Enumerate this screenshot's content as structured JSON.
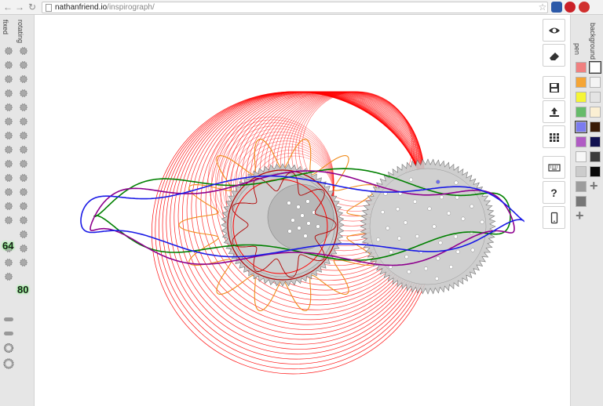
{
  "browser": {
    "url_host": "nathanfriend.io",
    "url_path": "/inspirograph/",
    "nav": [
      "back-icon",
      "forward-icon",
      "reload-icon"
    ],
    "extensions": [
      "star-icon",
      "bookmark-extension-icon",
      "pinterest-icon",
      "opera-icon"
    ]
  },
  "left_panel": {
    "fixed_label": "fixed",
    "rotating_label": "rotating",
    "selected_fixed_teeth": "64",
    "selected_rotating_teeth": "80"
  },
  "toolbar": {
    "tools": [
      "eye-icon",
      "eraser-icon",
      "save-icon",
      "upload-icon",
      "grid-icon",
      "keyboard-icon",
      "help-icon",
      "mobile-icon"
    ],
    "help_label": "?"
  },
  "right_panel": {
    "pen_label": "pen",
    "background_label": "background",
    "pen_colors": [
      "#f08080",
      "#f5a535",
      "#f5f535",
      "#66bb6a",
      "#7b7bef",
      "#b05bc4",
      "#f7f7f7",
      "#cccccc",
      "#9c9c9c",
      "#777777"
    ],
    "background_colors": [
      "#ffffff",
      "#f4f4f4",
      "#e4e4e4",
      "#fbefd3",
      "#3a1b06",
      "#101050",
      "#3c3c3c",
      "#0a0a0a"
    ],
    "selected_pen": "#7b7bef",
    "selected_background": "#ffffff",
    "add_label": "+"
  },
  "drawing": {
    "pens": [
      "#ff0000",
      "#f08c1c",
      "#008000",
      "#8e008e",
      "#1a1ae6",
      "#b00000"
    ],
    "gear_fill": "#bcbcbc"
  }
}
